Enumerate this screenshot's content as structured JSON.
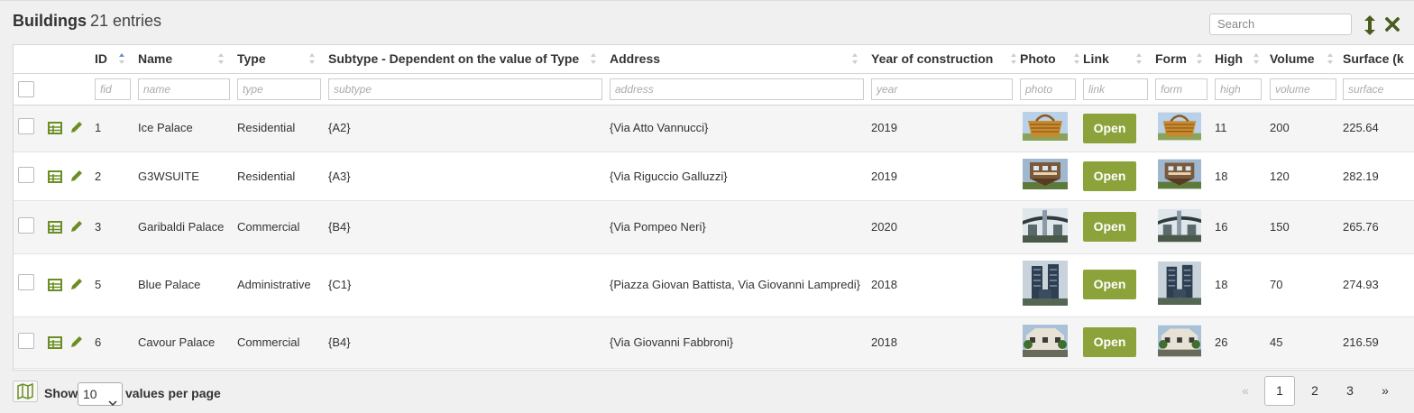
{
  "header": {
    "title": "Buildings",
    "count": "21 entries",
    "search_placeholder": "Search"
  },
  "columns": {
    "id": "ID",
    "name": "Name",
    "type": "Type",
    "subtype": "Subtype - Dependent on the value of Type",
    "address": "Address",
    "year": "Year of construction",
    "photo": "Photo",
    "link": "Link",
    "form": "Form",
    "high": "High",
    "volume": "Volume",
    "surface": "Surface (k"
  },
  "filters": {
    "id": "fid",
    "name": "name",
    "type": "type",
    "subtype": "subtype",
    "address": "address",
    "year": "year",
    "photo": "photo",
    "link": "link",
    "form": "form",
    "high": "high",
    "volume": "volume",
    "surface": "surface"
  },
  "rows": [
    {
      "id": "1",
      "name": "Ice Palace",
      "type": "Residential",
      "subtype": "{A2}",
      "address": "{Via Atto Vannucci}",
      "year": "2019",
      "link": "Open",
      "high": "11",
      "volume": "200",
      "surface": "225.64",
      "image": "basket-building"
    },
    {
      "id": "2",
      "name": "G3WSUITE",
      "type": "Residential",
      "subtype": "{A3}",
      "address": "{Via Riguccio Galluzzi}",
      "year": "2019",
      "link": "Open",
      "high": "18",
      "volume": "120",
      "surface": "282.19",
      "image": "upside-down-house"
    },
    {
      "id": "3",
      "name": "Garibaldi Palace",
      "type": "Commercial",
      "subtype": "{B4}",
      "address": "{Via Pompeo Neri}",
      "year": "2020",
      "link": "Open",
      "high": "16",
      "volume": "150",
      "surface": "265.76",
      "image": "tower-canopy"
    },
    {
      "id": "5",
      "name": "Blue Palace",
      "type": "Administrative",
      "subtype": "{C1}",
      "address": "{Piazza Giovan Battista, Via Giovanni Lampredi}",
      "year": "2018",
      "link": "Open",
      "high": "18",
      "volume": "70",
      "surface": "274.93",
      "image": "twin-towers"
    },
    {
      "id": "6",
      "name": "Cavour Palace",
      "type": "Commercial",
      "subtype": "{B4}",
      "address": "{Via Giovanni Fabbroni}",
      "year": "2018",
      "link": "Open",
      "high": "26",
      "volume": "45",
      "surface": "216.59",
      "image": "street-building"
    }
  ],
  "footer": {
    "show_label": "Show",
    "per_page_value": "10",
    "values_per_page_label": "values per page",
    "pagination": {
      "prev": "«",
      "pages": [
        "1",
        "2",
        "3"
      ],
      "current": "1",
      "next": "»"
    }
  },
  "colors": {
    "accent": "#8ca23a",
    "icon_green": "#6b8e23",
    "close_icon": "#4b5a1e"
  }
}
